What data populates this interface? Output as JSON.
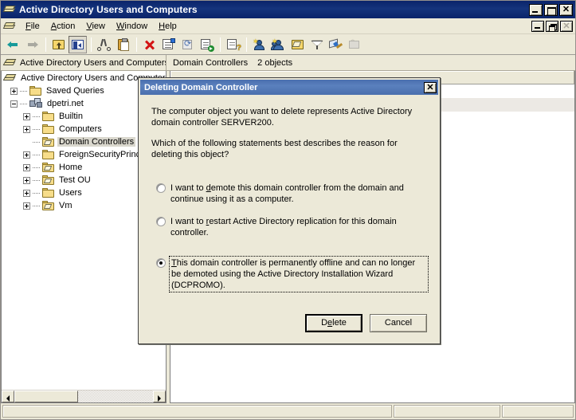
{
  "window": {
    "title": "Active Directory Users and Computers",
    "app_icon": "books-icon",
    "caption": {
      "minimize": "minimize-icon",
      "maximize": "maximize-icon",
      "close": "close-icon"
    },
    "mdi_caption": {
      "minimize": "minimize-icon",
      "restore": "restore-icon",
      "close": "close-icon"
    }
  },
  "menu": {
    "items": [
      {
        "pre": "",
        "acc": "F",
        "post": "ile",
        "name": "menu-file"
      },
      {
        "pre": "",
        "acc": "A",
        "post": "ction",
        "name": "menu-action"
      },
      {
        "pre": "",
        "acc": "V",
        "post": "iew",
        "name": "menu-view"
      },
      {
        "pre": "",
        "acc": "W",
        "post": "indow",
        "name": "menu-window"
      },
      {
        "pre": "",
        "acc": "H",
        "post": "elp",
        "name": "menu-help"
      }
    ]
  },
  "toolbar": {
    "buttons": [
      "back-icon",
      "forward-icon",
      "up-one-level-icon",
      "show-hide-console-tree-icon",
      "cut-icon",
      "paste-icon",
      "delete-icon",
      "properties-icon",
      "refresh-icon",
      "export-list-icon",
      "help-icon",
      "new-user-icon",
      "new-group-icon",
      "new-organizational-unit-icon",
      "filter-icon",
      "find-icon",
      "disabled-tool-icon"
    ]
  },
  "tree_header": {
    "icon": "books-icon",
    "label": "Active Directory Users and Computers"
  },
  "list_header_bar": {
    "title": "Domain Controllers",
    "count": "2 objects"
  },
  "tree": {
    "items": [
      {
        "label": "Active Directory Users and Computers",
        "indent": 0,
        "expander": "minus",
        "icon": "books-icon",
        "selected": false,
        "hidden": true
      },
      {
        "label": "Saved Queries",
        "indent": 1,
        "expander": "plus",
        "icon": "folder-icon",
        "selected": false
      },
      {
        "label": "dpetri.net",
        "indent": 1,
        "expander": "minus",
        "icon": "domain-icon",
        "selected": false
      },
      {
        "label": "Builtin",
        "indent": 2,
        "expander": "plus",
        "icon": "folder-icon",
        "selected": false
      },
      {
        "label": "Computers",
        "indent": 2,
        "expander": "plus",
        "icon": "folder-icon",
        "selected": false
      },
      {
        "label": "Domain Controllers",
        "indent": 2,
        "expander": "none",
        "icon": "ou-icon",
        "selected": true
      },
      {
        "label": "ForeignSecurityPrincip",
        "indent": 2,
        "expander": "plus",
        "icon": "folder-icon",
        "selected": false
      },
      {
        "label": "Home",
        "indent": 2,
        "expander": "plus",
        "icon": "ou-icon",
        "selected": false
      },
      {
        "label": "Test OU",
        "indent": 2,
        "expander": "plus",
        "icon": "ou-icon",
        "selected": false
      },
      {
        "label": "Users",
        "indent": 2,
        "expander": "plus",
        "icon": "folder-icon",
        "selected": false
      },
      {
        "label": "Vm",
        "indent": 2,
        "expander": "plus",
        "icon": "ou-icon",
        "selected": false
      }
    ]
  },
  "tree_scrollbar": {
    "left_arrow": "scroll-left-icon",
    "right_arrow": "scroll-right-icon",
    "thumb": "horizontal-scroll-thumb"
  },
  "list_pane": {
    "columns": [
      {
        "label": ""
      }
    ],
    "rows": [
      {
        "cells": [
          ""
        ]
      },
      {
        "cells": [
          ""
        ]
      }
    ]
  },
  "status_bar": {
    "main": "",
    "cell2": "",
    "cell3": ""
  },
  "dialog": {
    "title": "Deleting Domain Controller",
    "close_icon": "close-icon",
    "paragraph1": "The computer object you want to delete represents Active Directory domain controller SERVER200.",
    "paragraph2": "Which of the following statements best describes the reason for deleting this object?",
    "options": [
      {
        "checked": false,
        "focused": false,
        "pre": "I want to ",
        "acc": "d",
        "post": "emote this domain controller from the domain and continue using it as a computer.",
        "name": "radio-demote"
      },
      {
        "checked": false,
        "focused": false,
        "pre": "I want to ",
        "acc": "r",
        "post": "estart Active Directory replication for this domain controller.",
        "name": "radio-restart-replication"
      },
      {
        "checked": true,
        "focused": true,
        "pre": "",
        "acc": "T",
        "post": "his domain controller is permanently offline and can no longer be demoted using the Active Directory Installation Wizard (DCPROMO).",
        "name": "radio-permanently-offline"
      }
    ],
    "buttons": [
      {
        "pre": "D",
        "acc": "e",
        "post": "lete",
        "default": true,
        "name": "delete-button"
      },
      {
        "pre": "Cancel",
        "acc": "",
        "post": "",
        "default": false,
        "name": "cancel-button"
      }
    ]
  },
  "colors": {
    "title_bar": "#0a246a",
    "dialog_title_bar": "#4a6fae",
    "face": "#ece9d8",
    "selection_inactive": "#d9d7cd",
    "alt_row": "#ece9e4"
  }
}
